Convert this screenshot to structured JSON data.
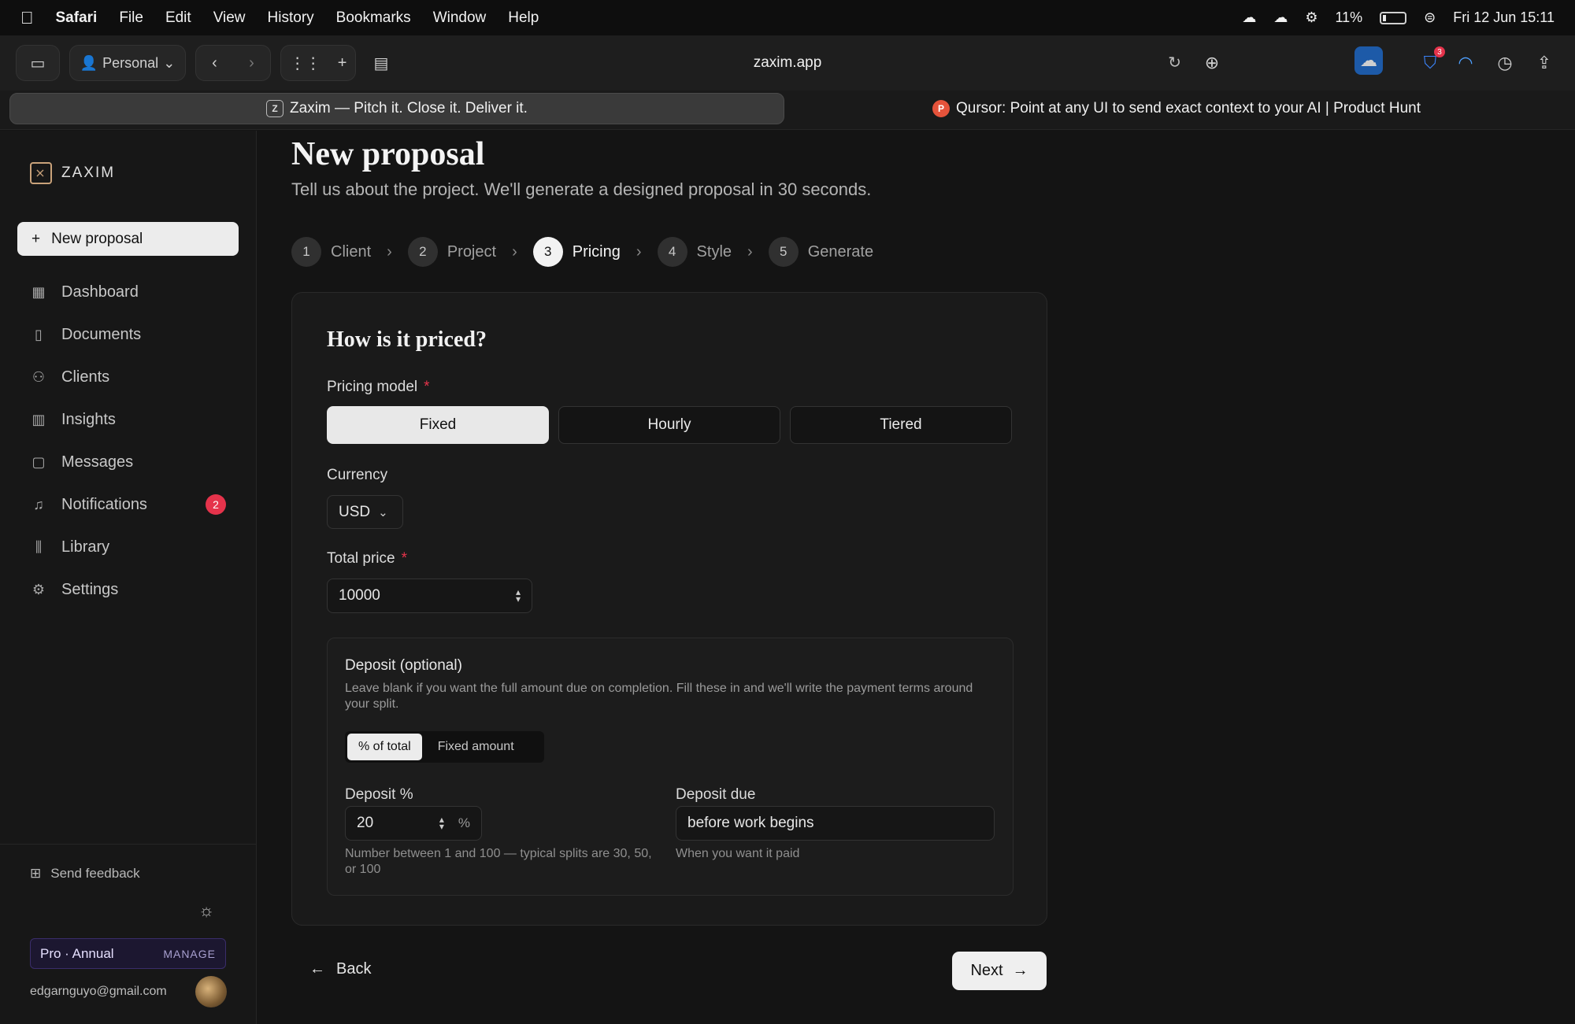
{
  "menubar": {
    "app": "Safari",
    "items": [
      "File",
      "Edit",
      "View",
      "History",
      "Bookmarks",
      "Window",
      "Help"
    ],
    "battery": "11%",
    "datetime": "Fri 12 Jun  15:11"
  },
  "toolbar": {
    "profile": "Personal",
    "address": "zaxim.app",
    "bitwarden_badge": "3"
  },
  "tabs": {
    "active": "Zaxim — Pitch it. Close it. Deliver it.",
    "inactive": "Qursor: Point at any UI to send exact context to your AI | Product Hunt",
    "inactive_favicon": "P"
  },
  "sidebar": {
    "brand": "ZAXIM",
    "new_button": "New proposal",
    "items": [
      {
        "label": "Dashboard",
        "icon": "grid-icon"
      },
      {
        "label": "Documents",
        "icon": "document-icon"
      },
      {
        "label": "Clients",
        "icon": "users-icon"
      },
      {
        "label": "Insights",
        "icon": "chart-icon"
      },
      {
        "label": "Messages",
        "icon": "message-icon"
      },
      {
        "label": "Notifications",
        "icon": "bell-icon",
        "badge": "2"
      },
      {
        "label": "Library",
        "icon": "library-icon"
      },
      {
        "label": "Settings",
        "icon": "gear-icon"
      }
    ],
    "feedback": "Send feedback",
    "plan": "Pro · Annual",
    "manage": "MANAGE",
    "email": "edgarnguyo@gmail.com"
  },
  "page": {
    "title": "New proposal",
    "subtitle": "Tell us about the project. We'll generate a designed proposal in 30 seconds.",
    "steps": [
      {
        "num": "1",
        "label": "Client"
      },
      {
        "num": "2",
        "label": "Project"
      },
      {
        "num": "3",
        "label": "Pricing"
      },
      {
        "num": "4",
        "label": "Style"
      },
      {
        "num": "5",
        "label": "Generate"
      }
    ],
    "active_step": "3"
  },
  "form": {
    "heading": "How is it priced?",
    "pricing_model_label": "Pricing model",
    "pricing_options": [
      "Fixed",
      "Hourly",
      "Tiered"
    ],
    "pricing_selected": "Fixed",
    "currency_label": "Currency",
    "currency_value": "USD",
    "total_price_label": "Total price",
    "total_price_value": "10000",
    "deposit": {
      "title": "Deposit (optional)",
      "help": "Leave blank if you want the full amount due on completion. Fill these in and we'll write the payment terms around your split.",
      "toggle": [
        "% of total",
        "Fixed amount"
      ],
      "toggle_selected": "% of total",
      "percent_label": "Deposit %",
      "percent_value": "20",
      "percent_suffix": "%",
      "percent_note": "Number between 1 and 100 — typical splits are 30, 50, or 100",
      "due_label": "Deposit due",
      "due_value": "before work begins",
      "due_note": "When you want it paid"
    }
  },
  "footer": {
    "back": "Back",
    "next": "Next"
  },
  "colors": {
    "background": "#141414",
    "accent_required": "#e5334b",
    "plan_purple": "#1c1730"
  }
}
